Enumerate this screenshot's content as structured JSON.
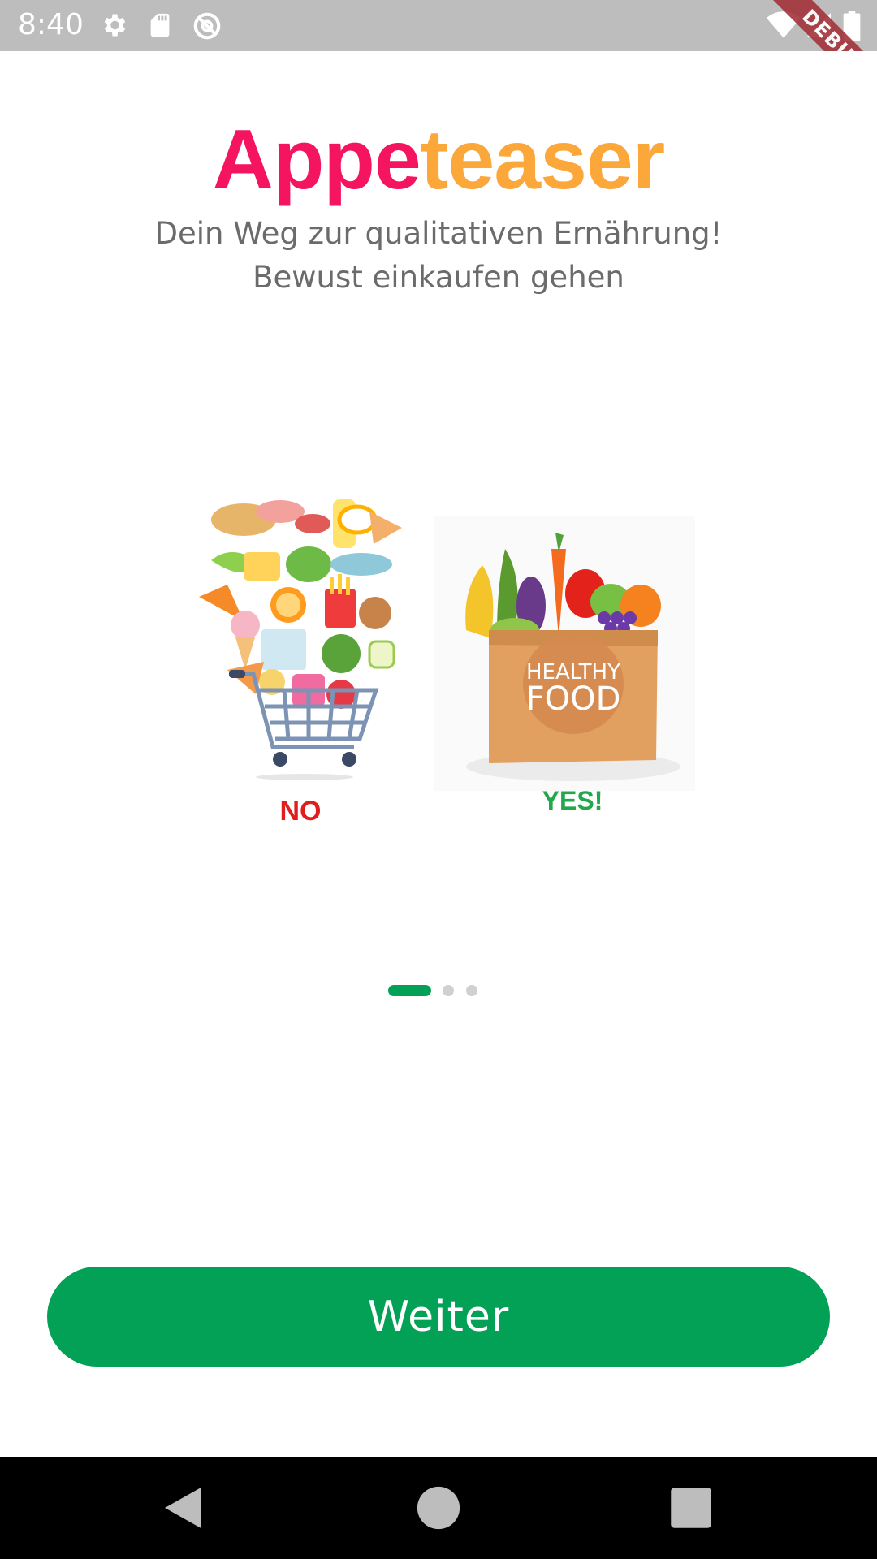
{
  "status_bar": {
    "time": "8:40",
    "debug_label": "DEBUG",
    "icons": [
      "settings-icon",
      "sd-card-icon",
      "no-location-icon",
      "wifi-icon",
      "signal-icon",
      "battery-icon"
    ]
  },
  "header": {
    "title_part1": "Appe",
    "title_part2": "teaser",
    "subtitle_line1": "Dein Weg zur qualitativen Ernährung!",
    "subtitle_line2": "Bewust einkaufen gehen"
  },
  "illustration": {
    "left_label": "NO",
    "right_label": "YES!",
    "bag_text_line1": "HEALTHY",
    "bag_text_line2": "FOOD"
  },
  "pager": {
    "total_pages": 3,
    "active_index": 0
  },
  "actions": {
    "continue_label": "Weiter"
  },
  "colors": {
    "title_primary": "#f4145f",
    "title_secondary": "#fca73a",
    "accent_green": "#03a155",
    "no_red": "#e11d1d",
    "yes_green": "#22a84a"
  },
  "nav_bar": {
    "icons": [
      "back-icon",
      "home-icon",
      "recents-icon"
    ]
  }
}
